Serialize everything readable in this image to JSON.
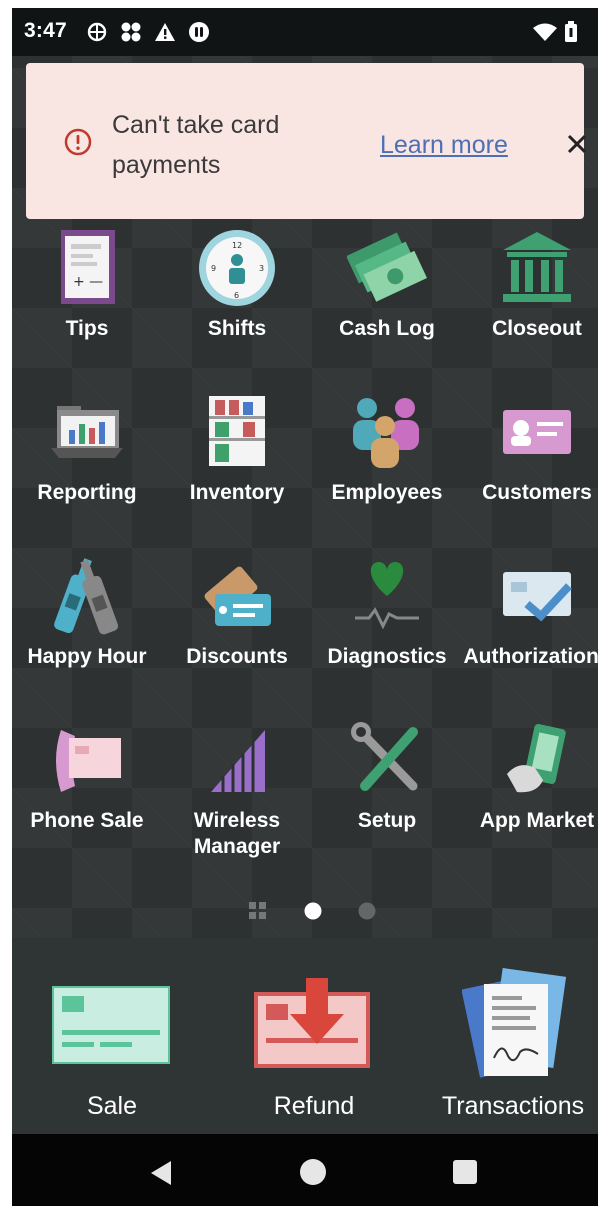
{
  "status_bar": {
    "time": "3:47"
  },
  "banner": {
    "message": "Can't take card payments",
    "link": "Learn more"
  },
  "apps": [
    {
      "label": "Tips"
    },
    {
      "label": "Shifts"
    },
    {
      "label": "Cash Log"
    },
    {
      "label": "Closeout"
    },
    {
      "label": "Reporting"
    },
    {
      "label": "Inventory"
    },
    {
      "label": "Employees"
    },
    {
      "label": "Customers"
    },
    {
      "label": "Happy Hour"
    },
    {
      "label": "Discounts"
    },
    {
      "label": "Diagnostics"
    },
    {
      "label": "Authorizations"
    },
    {
      "label": "Phone Sale"
    },
    {
      "label": "Wireless Manager"
    },
    {
      "label": "Setup"
    },
    {
      "label": "App Market"
    }
  ],
  "pager": {
    "pages": 2,
    "current": 1
  },
  "dock": [
    {
      "label": "Sale"
    },
    {
      "label": "Refund"
    },
    {
      "label": "Transactions"
    }
  ],
  "colors": {
    "banner_bg": "#f9e6e3",
    "link": "#4c6fb5",
    "error": "#c0392b",
    "brand_green": "#5cc49a"
  }
}
